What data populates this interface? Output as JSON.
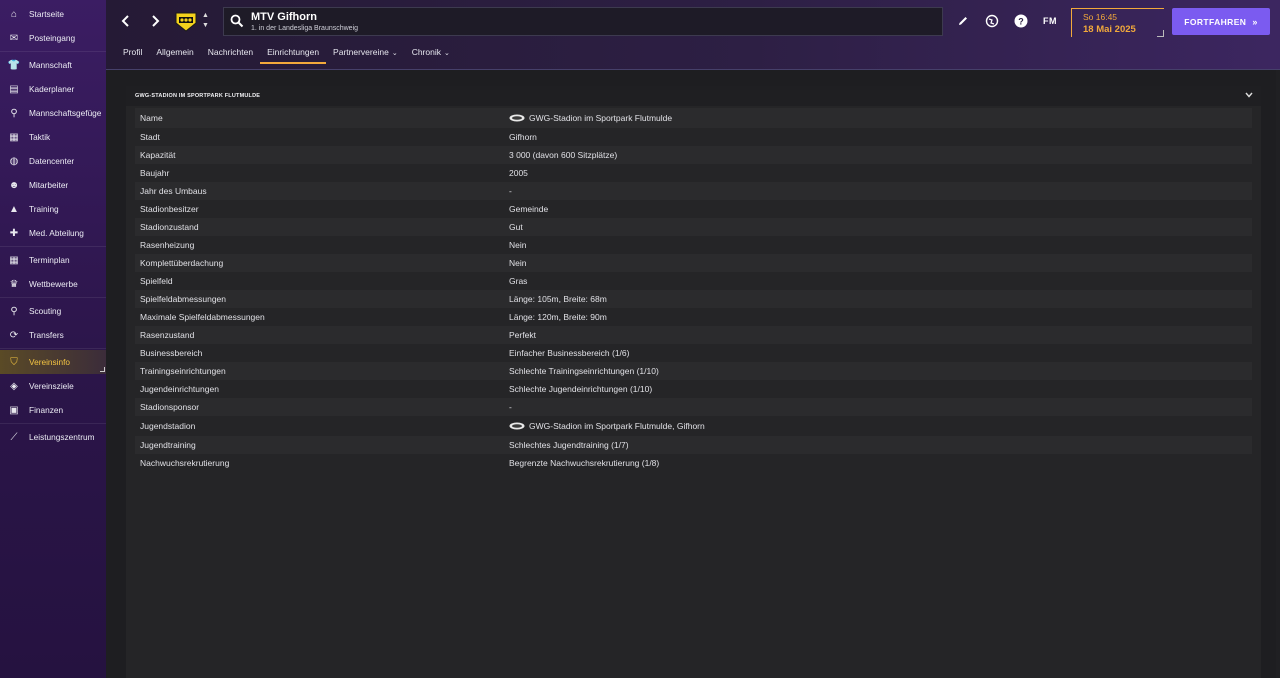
{
  "sidebar": {
    "items": [
      {
        "label": "Startseite",
        "icon": "home-icon"
      },
      {
        "label": "Posteingang",
        "icon": "inbox-icon"
      },
      {
        "label": "Mannschaft",
        "icon": "shirt-icon"
      },
      {
        "label": "Kaderplaner",
        "icon": "clipboard-icon"
      },
      {
        "label": "Mannschaftsgefüge",
        "icon": "hierarchy-icon"
      },
      {
        "label": "Taktik",
        "icon": "tactics-board-icon"
      },
      {
        "label": "Datencenter",
        "icon": "data-icon"
      },
      {
        "label": "Mitarbeiter",
        "icon": "staff-icon"
      },
      {
        "label": "Training",
        "icon": "training-icon"
      },
      {
        "label": "Med. Abteilung",
        "icon": "medical-icon"
      },
      {
        "label": "Terminplan",
        "icon": "calendar-icon"
      },
      {
        "label": "Wettbewerbe",
        "icon": "trophy-icon"
      },
      {
        "label": "Scouting",
        "icon": "magnifier-icon"
      },
      {
        "label": "Transfers",
        "icon": "transfer-icon"
      },
      {
        "label": "Vereinsinfo",
        "icon": "shield-icon"
      },
      {
        "label": "Vereinsziele",
        "icon": "goals-icon"
      },
      {
        "label": "Finanzen",
        "icon": "money-icon"
      },
      {
        "label": "Leistungszentrum",
        "icon": "performance-icon"
      }
    ],
    "active": "Vereinsinfo"
  },
  "header": {
    "club_name": "MTV Gifhorn",
    "club_league": "1. in der Landesliga Braunschweig",
    "time": "So 16:45",
    "date": "18 Mai 2025",
    "continue_label": "FORTFAHREN",
    "fm_logo": "FM",
    "accent_color": "#f2a93b",
    "button_color": "#7b5bf0"
  },
  "tabs": [
    {
      "label": "Profil",
      "dropdown": false
    },
    {
      "label": "Allgemein",
      "dropdown": false
    },
    {
      "label": "Nachrichten",
      "dropdown": false
    },
    {
      "label": "Einrichtungen",
      "dropdown": false,
      "active": true
    },
    {
      "label": "Partnervereine",
      "dropdown": true
    },
    {
      "label": "Chronik",
      "dropdown": true
    }
  ],
  "panel": {
    "title": "GWG-STADION IM SPORTPARK FLUTMULDE",
    "rows": [
      {
        "label": "Name",
        "value": "GWG-Stadion im Sportpark Flutmulde",
        "icon": true
      },
      {
        "label": "Stadt",
        "value": "Gifhorn"
      },
      {
        "label": "Kapazität",
        "value": "3 000 (davon 600 Sitzplätze)"
      },
      {
        "label": "Baujahr",
        "value": "2005"
      },
      {
        "label": "Jahr des Umbaus",
        "value": "-"
      },
      {
        "label": "Stadionbesitzer",
        "value": "Gemeinde"
      },
      {
        "label": "Stadionzustand",
        "value": "Gut"
      },
      {
        "label": "Rasenheizung",
        "value": "Nein"
      },
      {
        "label": "Komplettüberdachung",
        "value": "Nein"
      },
      {
        "label": "Spielfeld",
        "value": "Gras"
      },
      {
        "label": "Spielfeldabmessungen",
        "value": "Länge: 105m, Breite: 68m"
      },
      {
        "label": "Maximale Spielfeldabmessungen",
        "value": "Länge: 120m, Breite: 90m"
      },
      {
        "label": "Rasenzustand",
        "value": "Perfekt"
      },
      {
        "label": "Businessbereich",
        "value": "Einfacher Businessbereich (1/6)"
      },
      {
        "label": "Trainingseinrichtungen",
        "value": "Schlechte Trainingseinrichtungen (1/10)"
      },
      {
        "label": "Jugendeinrichtungen",
        "value": "Schlechte Jugendeinrichtungen (1/10)"
      },
      {
        "label": "Stadionsponsor",
        "value": "-"
      },
      {
        "label": "Jugendstadion",
        "value": "GWG-Stadion im Sportpark Flutmulde, Gifhorn",
        "icon": true
      },
      {
        "label": "Jugendtraining",
        "value": "Schlechtes Jugendtraining (1/7)"
      },
      {
        "label": "Nachwuchsrekrutierung",
        "value": "Begrenzte Nachwuchsrekrutierung (1/8)"
      }
    ]
  }
}
